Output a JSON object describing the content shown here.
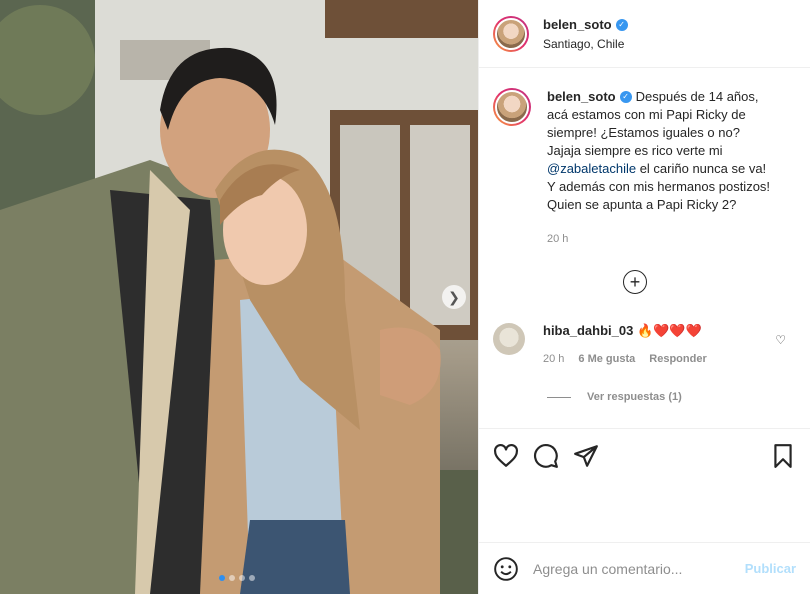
{
  "header": {
    "username": "belen_soto",
    "location": "Santiago, Chile"
  },
  "caption": {
    "username": "belen_soto",
    "text_1": "Después de 14 años, acá estamos con mi Papi Ricky de siempre! ¿Estamos iguales o no? Jajaja siempre es rico verte mi ",
    "mention": "@zabaletachile",
    "text_2": " el cariño nunca se va! Y además con mis hermanos postizos! Quien se apunta a Papi Ricky 2?",
    "time": "20 h"
  },
  "load_more_icon": "+",
  "comment": {
    "username": "hiba_dahbi_03",
    "text": "🔥❤️❤️❤️",
    "time": "20 h",
    "likes": "6 Me gusta",
    "reply": "Responder"
  },
  "view_replies": "Ver respuestas (1)",
  "comment_box": {
    "placeholder": "Agrega un comentario...",
    "publish_label": "Publicar"
  },
  "carousel": {
    "dots": 4,
    "active": 1
  },
  "colors": {
    "accent": "#3897f0",
    "publish_disabled": "#b2dffc"
  }
}
